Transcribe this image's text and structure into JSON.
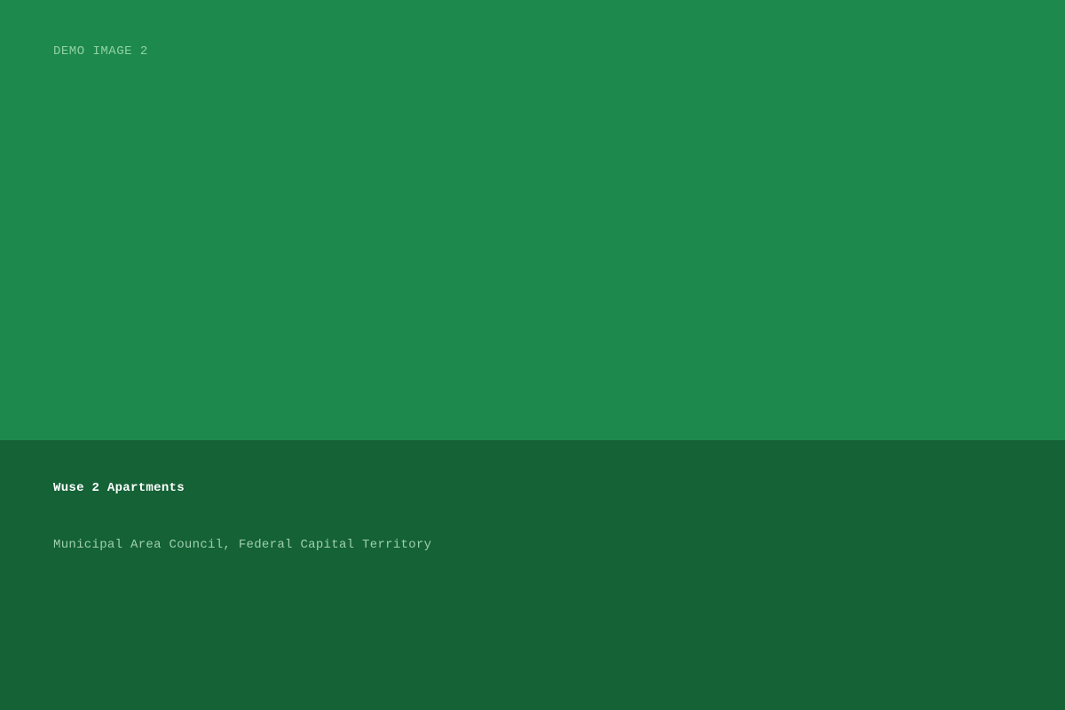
{
  "image_panel": {
    "label": "DEMO IMAGE 2",
    "background_color": "#1e894c",
    "label_color": "#8fd1a6"
  },
  "info_panel": {
    "title": "Wuse 2 Apartments",
    "location": "Municipal Area Council, Federal Capital Territory",
    "background_color": "#146236",
    "title_color": "#ffffff",
    "location_color": "#9fcfb1"
  }
}
